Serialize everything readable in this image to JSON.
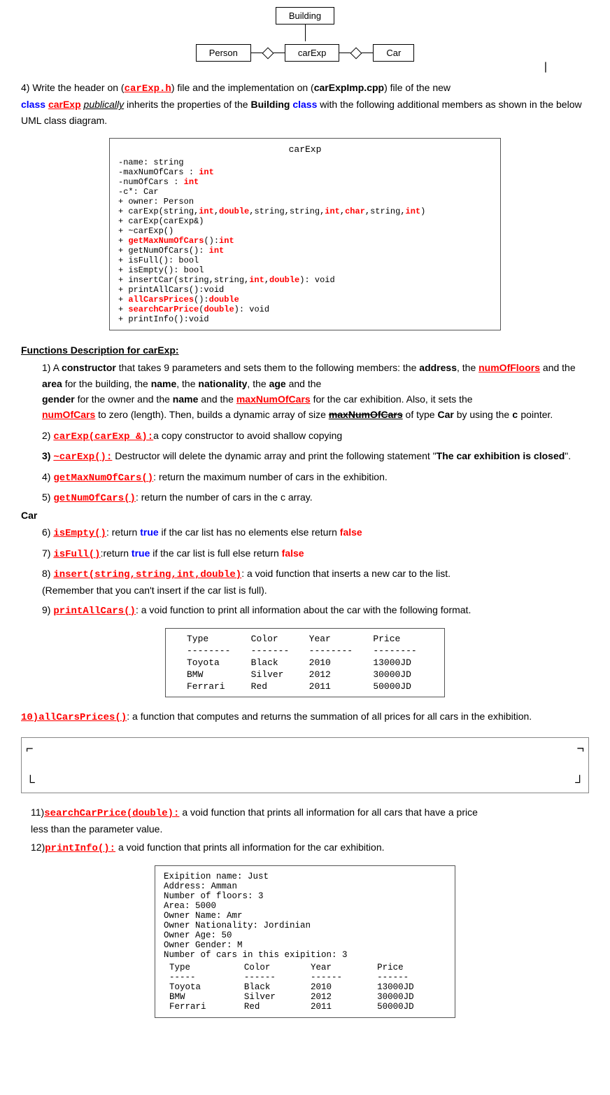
{
  "diagram": {
    "building_label": "Building",
    "person_label": "Person",
    "carexp_label": "carExp",
    "car_label": "Car"
  },
  "intro_text": {
    "part1": "4) Write the header on (",
    "carexp_h": "carExp.h",
    "part2": ") file and the implementation on (",
    "carexpimp": "carExpImp.cpp",
    "part3": ") file of the new",
    "class_label": "class",
    "carexp_cls": "carExp",
    "publicly": "publically",
    "inherits": " inherits the properties of the ",
    "Building": "Building",
    "class2": "class",
    "rest": " with the following additional members as shown in the below UML class diagram."
  },
  "uml_box": {
    "title": "carExp",
    "lines": [
      "-name: string",
      "-maxNumOfCars : int",
      "-numOfCars : int",
      "-c*: Car",
      "+ owner: Person",
      "+ carExp(string,int,double,string,string,int,char,string,int)",
      "+ carExp(carExp&)",
      "+ ~carExp()",
      "+ getMaxNumOfCars():int",
      "+ getNumOfCars(): int",
      "+ isFull(): bool",
      "+ isEmpty(): bool",
      "+ insertCar(string,string,int,double): void",
      "+ printAllCars():void",
      "+ allCarsPrices():double",
      "+ searchCarPrice(double): void",
      "+ printInfo():void"
    ]
  },
  "functions_title": "Functions Description for carExp:",
  "functions": {
    "f1_label": "1)",
    "f1_keyword": "constructor",
    "f1_text1": " that takes 9 parameters and sets them to the following members: the ",
    "f1_address": "address",
    "f1_text2": ", the ",
    "f1_numOfFloors": "numOfFloors",
    "f1_text3": " and the ",
    "f1_area": "area",
    "f1_text4": " for the building, the ",
    "f1_name": "name",
    "f1_text5": ", the ",
    "f1_nationality": "nationality",
    "f1_text6": ", the ",
    "f1_age": "age",
    "f1_text7": " and the ",
    "f1_gender": "gender",
    "f1_text8": " for the owner and the ",
    "f1_name2": "name",
    "f1_text9": " and the ",
    "f1_maxNumOfCars": "maxNumOfCars",
    "f1_text10": " for the car exhibition. Also, it sets the ",
    "f1_numOfCars": "numOfCars",
    "f1_text11": " to zero (length). Then, builds a dynamic array of size ",
    "f1_maxNumOfCars2": "maxNumOfCars",
    "f1_text12": " of type ",
    "f1_Car": "Car",
    "f1_text13": " by using the ",
    "f1_c": "c",
    "f1_text14": " pointer.",
    "f2_label": "2)",
    "f2_func": "carExp(carExp &):",
    "f2_text": "a copy constructor to avoid shallow copying",
    "f3_label": "3)",
    "f3_func": "~carExp():",
    "f3_text1": " Destructor will delete the dynamic array and print the following statement \"",
    "f3_bold": "The car exhibition is closed",
    "f3_text2": "\".",
    "f4_label": "4)",
    "f4_func": "getMaxNumOfCars()",
    "f4_text": ": return the maximum number of cars in the exhibition.",
    "f5_label": "5)",
    "f5_func": "getNumOfCars()",
    "f5_text": ": return the number of cars in the c array.",
    "car_label": "Car",
    "f6_label": "6)",
    "f6_func": "isEmpty()",
    "f6_text1": ": return ",
    "f6_true": "true",
    "f6_text2": " if the car list has no elements else return ",
    "f6_false": "false",
    "f7_label": "7)",
    "f7_func": "isFull()",
    "f7_text1": ":return ",
    "f7_true": "true",
    "f7_text2": " if the car list is full else return ",
    "f7_false": "false",
    "f8_label": "8)",
    "f8_func": "insert(string,string,int,double)",
    "f8_text": ": a void function that inserts a new car to the list.",
    "f8_note": "(Remember that you can't insert if the car list is full).",
    "f9_label": "9)",
    "f9_func": "printAllCars()",
    "f9_text": ": a void function to print all information about the car with the following format."
  },
  "table1": {
    "headers": [
      "Type",
      "Color",
      "Year",
      "Price"
    ],
    "sep": [
      "--------",
      "-------",
      "--------",
      "--------"
    ],
    "rows": [
      [
        "Toyota",
        "Black",
        "2010",
        "13000JD"
      ],
      [
        "BMW",
        "Silver",
        "2012",
        "30000JD"
      ],
      [
        "Ferrari",
        "Red",
        "2011",
        "50000JD"
      ]
    ]
  },
  "f10": {
    "label": "10)",
    "func": "allCarsPrices()",
    "text": ": a function that computes and returns the summation of all prices for all cars in the exhibition."
  },
  "f11": {
    "label": "11)",
    "func": "searchCarPrice(double):",
    "text1": " a void function that prints all information for all cars that have a price less than the parameter value."
  },
  "f12": {
    "label": "12)",
    "func": "printInfo():",
    "text": " a void function that prints all information for the car exhibition."
  },
  "printinfo_box": {
    "lines": [
      "Exipition name: Just",
      "Address: Amman",
      "Number of floors: 3",
      "Area: 5000",
      "Owner Name: Amr",
      "Owner Nationality: Jordinian",
      "Owner Age: 50",
      "Owner Gender: M",
      "Number of cars in this exipition: 3"
    ],
    "table_headers": [
      "Type",
      "Color",
      "Year",
      "Price"
    ],
    "table_sep": [
      "-----",
      "------",
      "------",
      "------"
    ],
    "table_rows": [
      [
        "Toyota",
        "Black",
        "2010",
        "13000JD"
      ],
      [
        "BMW",
        "Silver",
        "2012",
        "30000JD"
      ],
      [
        "Ferrari",
        "Red",
        "2011",
        "50000JD"
      ]
    ]
  }
}
